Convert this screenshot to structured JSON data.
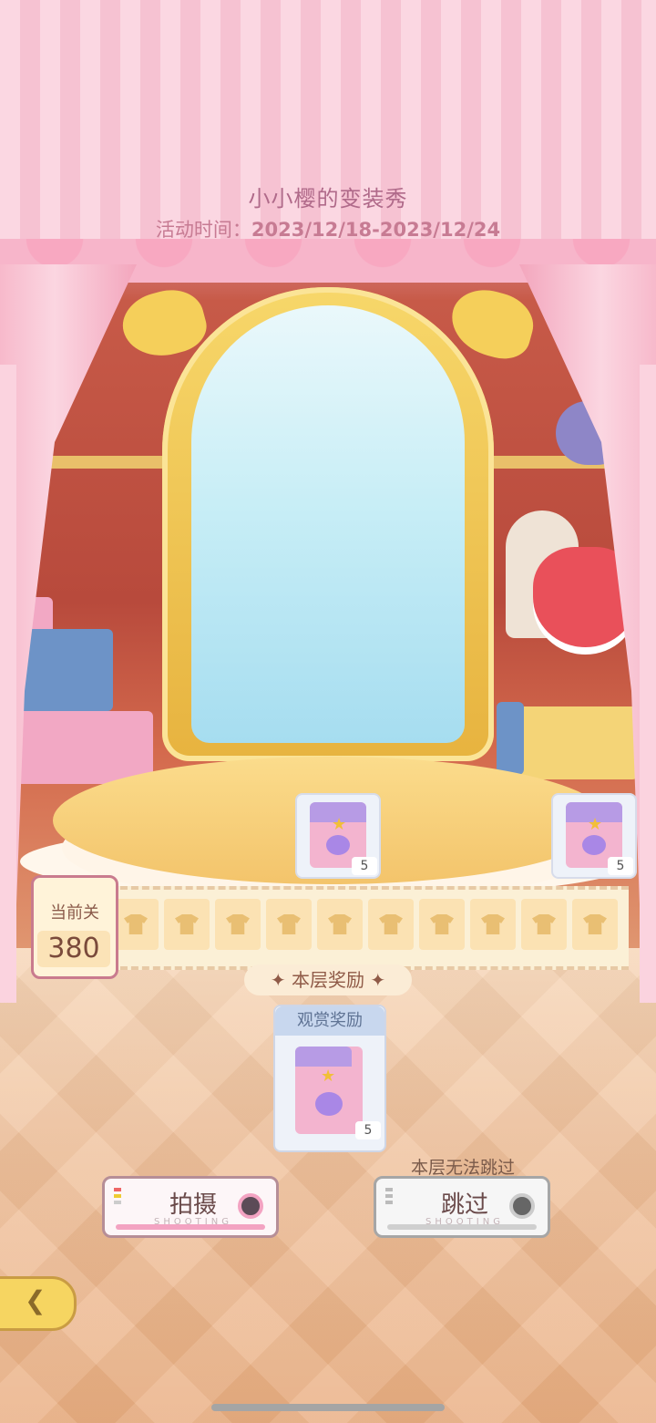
{
  "header": {
    "title": "小小樱的变装秀",
    "time_label": "活动时间：",
    "time_range": "2023/12/18-2023/12/24"
  },
  "level": {
    "label": "当前关",
    "number": "380"
  },
  "track_rewards": [
    {
      "qty": "5"
    },
    {
      "qty": "5"
    }
  ],
  "floor_reward": {
    "title": "本层奖励",
    "card_header": "观赏奖励",
    "qty": "5"
  },
  "buttons": {
    "shoot_label": "拍摄",
    "shoot_sub": "SHOOTING",
    "skip_label": "跳过",
    "skip_sub": "SHOOTING",
    "skip_note": "本层无法跳过"
  },
  "colors": {
    "accent_pink": "#f3a3c2",
    "gold": "#e7b33f"
  },
  "icons": {
    "back": "back-arrow-icon",
    "tshirt": "tshirt-icon",
    "gift_bag": "gift-bag-icon",
    "camera_lens": "camera-lens-icon"
  }
}
